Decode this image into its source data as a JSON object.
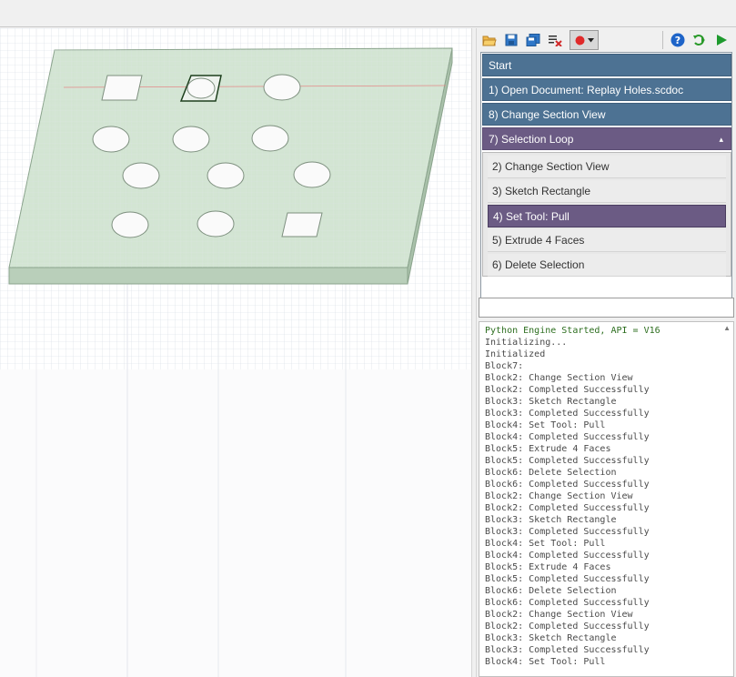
{
  "toolbar": {
    "buttons": [
      "open-icon",
      "save-icon",
      "save-as-icon",
      "clear-icon",
      "record-icon",
      "help-icon",
      "replay-icon",
      "run-icon"
    ]
  },
  "steps": {
    "start": "Start",
    "open_doc": "1) Open Document: Replay Holes.scdoc",
    "change_section": "8) Change Section View",
    "selection_loop": "7) Selection Loop",
    "loop_caret": "▴",
    "sub_items": [
      "2) Change Section View",
      "3) Sketch Rectangle",
      "4) Set Tool: Pull",
      "5) Extrude 4 Faces",
      "6) Delete Selection"
    ],
    "active_sub_index": 2
  },
  "console": {
    "lines": [
      "Python Engine Started, API = V16",
      "Initializing...",
      "Initialized",
      "Block7:",
      "Block2: Change Section View",
      "Block2: Completed Successfully",
      "Block3: Sketch Rectangle",
      "Block3: Completed Successfully",
      "Block4: Set Tool: Pull",
      "Block4: Completed Successfully",
      "Block5: Extrude 4 Faces",
      "Block5: Completed Successfully",
      "Block6: Delete Selection",
      "Block6: Completed Successfully",
      "Block2: Change Section View",
      "Block2: Completed Successfully",
      "Block3: Sketch Rectangle",
      "Block3: Completed Successfully",
      "Block4: Set Tool: Pull",
      "Block4: Completed Successfully",
      "Block5: Extrude 4 Faces",
      "Block5: Completed Successfully",
      "Block6: Delete Selection",
      "Block6: Completed Successfully",
      "Block2: Change Section View",
      "Block2: Completed Successfully",
      "Block3: Sketch Rectangle",
      "Block3: Completed Successfully",
      "Block4: Set Tool: Pull"
    ]
  },
  "colors": {
    "step_blue": "#4d7293",
    "step_purple": "#6b5b84",
    "plate_green": "#cfe3cf",
    "console_green": "#2d6e1f"
  }
}
